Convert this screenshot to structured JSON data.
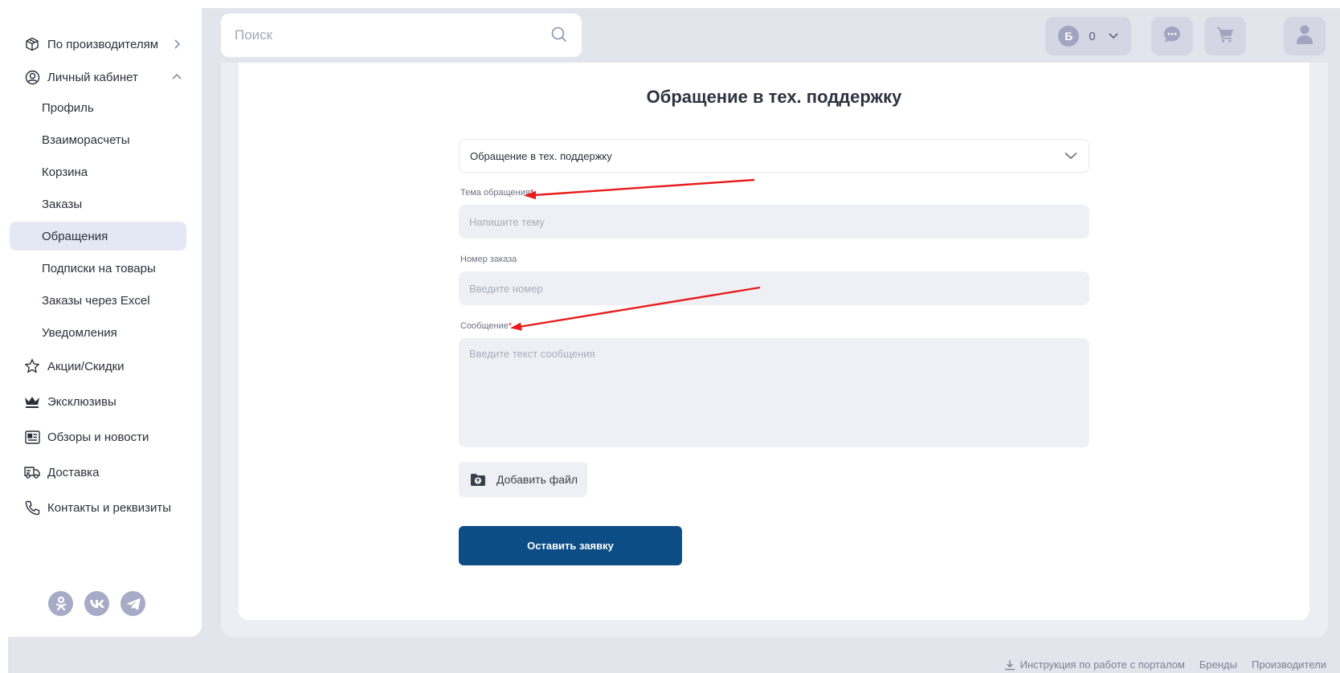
{
  "sidebar": {
    "items": [
      {
        "label": "По производителям",
        "icon": "box-icon",
        "chevron": "chevron-right-icon"
      },
      {
        "label": "Личный кабинет",
        "icon": "user-circle-icon",
        "chevron": "chevron-up-icon"
      }
    ],
    "sub_items": [
      {
        "label": "Профиль"
      },
      {
        "label": "Взаиморасчеты"
      },
      {
        "label": "Корзина"
      },
      {
        "label": "Заказы"
      },
      {
        "label": "Обращения",
        "active": true
      },
      {
        "label": "Подписки на товары"
      },
      {
        "label": "Заказы через Excel"
      },
      {
        "label": "Уведомления"
      }
    ],
    "bottom_items": [
      {
        "label": "Акции/Скидки",
        "icon": "star-icon"
      },
      {
        "label": "Эксклюзивы",
        "icon": "crown-icon"
      },
      {
        "label": "Обзоры и новости",
        "icon": "news-icon"
      },
      {
        "label": "Доставка",
        "icon": "truck-icon"
      },
      {
        "label": "Контакты и реквизиты",
        "icon": "phone-icon"
      }
    ],
    "socials": [
      "odnoklassniki-icon",
      "vk-icon",
      "telegram-icon"
    ]
  },
  "header": {
    "search_placeholder": "Поиск",
    "bonus_badge": "Б",
    "bonus_value": "0"
  },
  "form": {
    "title": "Обращение в тех. поддержку",
    "type_select": "Обращение в тех. поддержку",
    "subject_label": "Тема обращения",
    "subject_placeholder": "Напишите тему",
    "order_label": "Номер заказа",
    "order_placeholder": "Введите номер",
    "message_label": "Сообщение",
    "message_placeholder": "Введите текст сообщения",
    "required_mark": "*",
    "attach_label": "Добавить файл",
    "submit_label": "Оставить заявку"
  },
  "footer": {
    "instruction": "Инструкция по работе с порталом",
    "brands": "Бренды",
    "manufacturers": "Производители"
  },
  "colors": {
    "accent": "#0c4d86",
    "active_bg": "#e4e7f4",
    "page_bg": "#e3e5ec",
    "annotation_arrow": "#e81c1c"
  }
}
